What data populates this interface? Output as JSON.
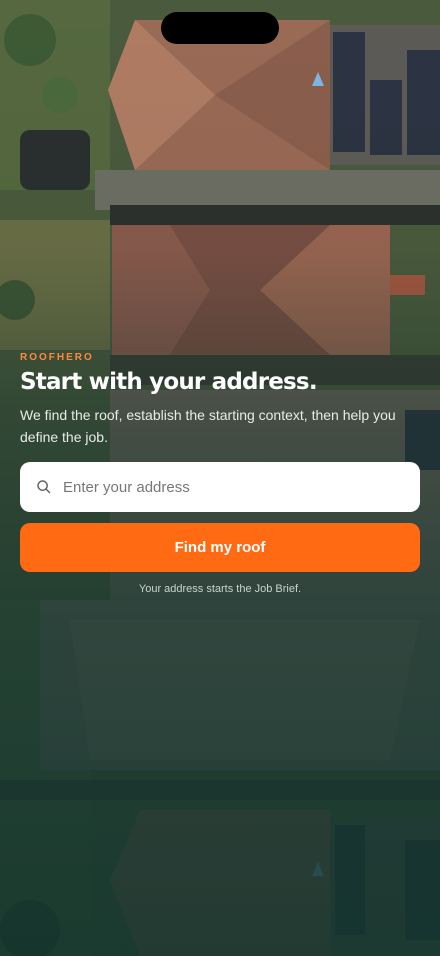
{
  "brand": "ROOFHERO",
  "title": "Start with your address.",
  "subtitle": "We find the roof, establish the starting context, then help you define the job.",
  "search": {
    "placeholder": "Enter your address",
    "icon": "search-icon"
  },
  "cta_label": "Find my roof",
  "helper": "Your address starts the Job Brief.",
  "colors": {
    "accent": "#ff6a13",
    "brand_text": "#ff8a3d",
    "overlay": "#143430"
  }
}
